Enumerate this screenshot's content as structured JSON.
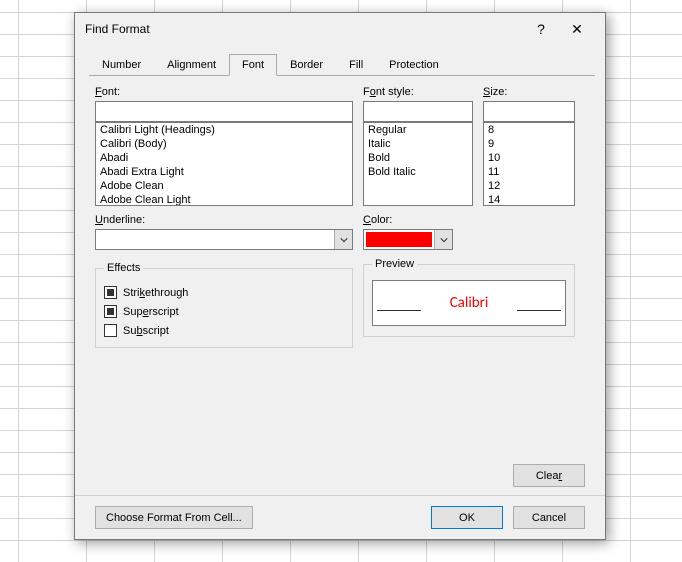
{
  "dialog": {
    "title": "Find Format",
    "help": "?",
    "close": "✕"
  },
  "tabs": {
    "items": [
      "Number",
      "Alignment",
      "Font",
      "Border",
      "Fill",
      "Protection"
    ],
    "active": "Font"
  },
  "font": {
    "label": "Font:",
    "value": "",
    "list": [
      "Calibri Light (Headings)",
      "Calibri (Body)",
      "Abadi",
      "Abadi Extra Light",
      "Adobe Clean",
      "Adobe Clean Light"
    ]
  },
  "fontStyle": {
    "label": "Font style:",
    "value": "",
    "list": [
      "Regular",
      "Italic",
      "Bold",
      "Bold Italic"
    ]
  },
  "size": {
    "label": "Size:",
    "value": "",
    "list": [
      "8",
      "9",
      "10",
      "11",
      "12",
      "14"
    ]
  },
  "underline": {
    "label": "Underline:",
    "value": ""
  },
  "color": {
    "label": "Color:",
    "value": "#fe0000"
  },
  "effects": {
    "legend": "Effects",
    "strikethrough": {
      "label": "Strikethrough",
      "state": "filled"
    },
    "superscript": {
      "label": "Superscript",
      "state": "filled"
    },
    "subscript": {
      "label": "Subscript",
      "state": "empty"
    }
  },
  "preview": {
    "legend": "Preview",
    "text": "Calibri",
    "color": "#ff0000"
  },
  "buttons": {
    "clear": "Clear",
    "chooseFormat": "Choose Format From Cell...",
    "ok": "OK",
    "cancel": "Cancel"
  }
}
